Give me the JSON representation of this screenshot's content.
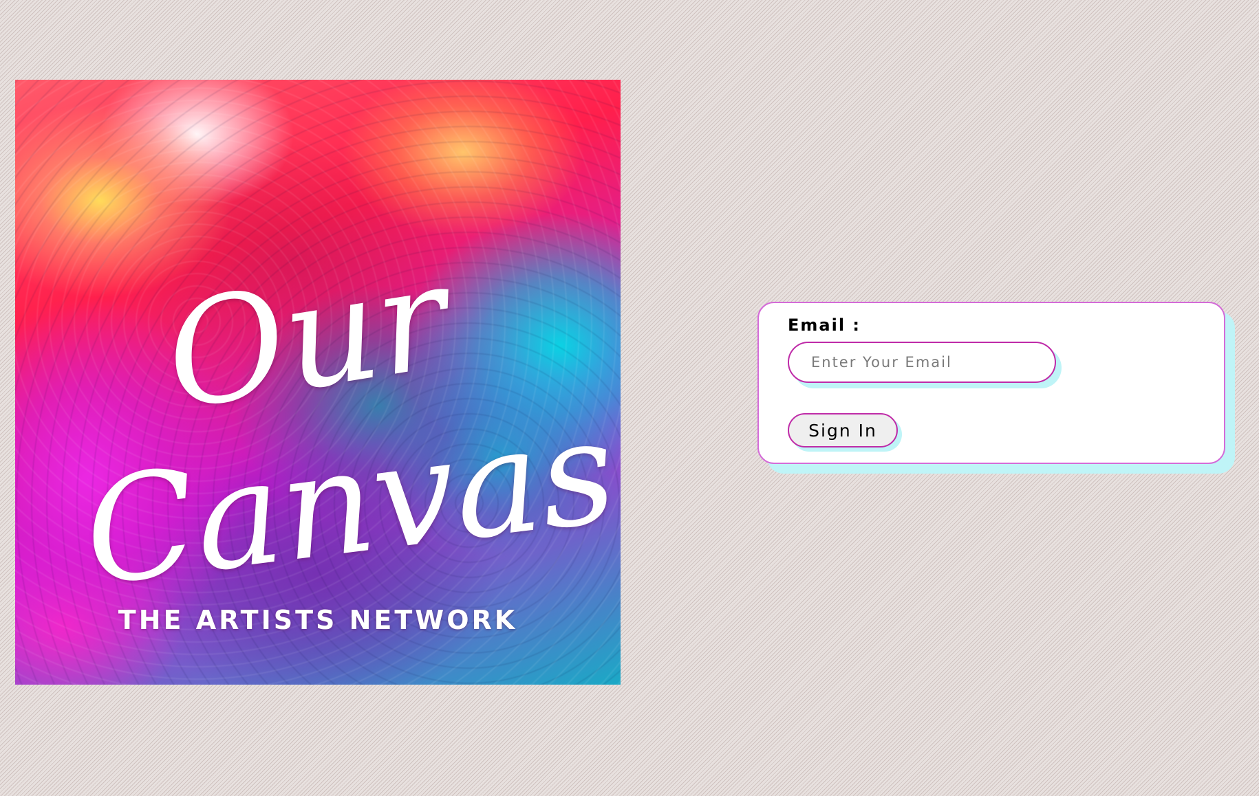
{
  "artwork": {
    "title_line1": "Our",
    "title_line2": "Canvas",
    "subtitle": "THE ARTISTS NETWORK"
  },
  "signin_form": {
    "email_label": "Email :",
    "email_placeholder": "Enter Your Email",
    "email_value": "",
    "sign_in_label": "Sign In"
  },
  "colors": {
    "page_background": "#e6dfdd",
    "card_border": "#d46bd8",
    "input_border": "#bf2ba8",
    "shadow_accent": "#bff4f7",
    "button_background": "#efefef"
  }
}
